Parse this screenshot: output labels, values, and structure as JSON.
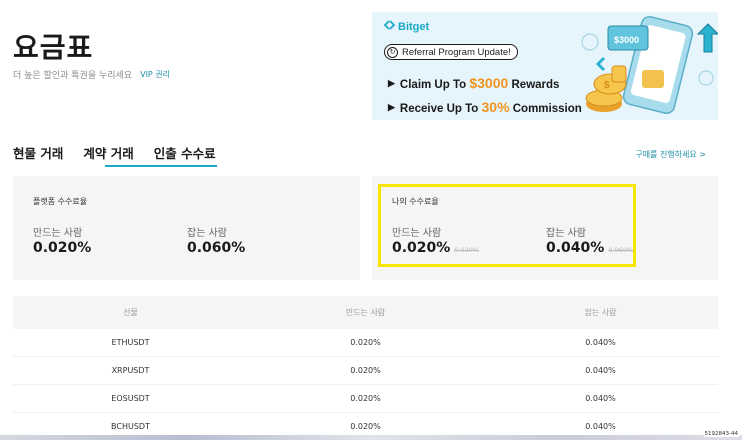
{
  "header": {
    "title": "요금표",
    "subtitle": "더 높은 할인과 특권을 누리세요",
    "vip_link": "VIP 권리"
  },
  "banner": {
    "brand": "Bitget",
    "pill_text": "Referral Program Update!",
    "line1_prefix": "Claim Up To ",
    "line1_highlight": "$3000",
    "line1_suffix": " Rewards",
    "line2_prefix": "Receive Up To ",
    "line2_highlight": "30%",
    "line2_suffix": " Commission",
    "colors": {
      "background": "#e6f5fb",
      "brand": "#1aa9c9",
      "highlight": "#f0941e"
    }
  },
  "tabs": [
    {
      "label": "현물 거래",
      "active": false
    },
    {
      "label": "계약 거래",
      "active": true
    },
    {
      "label": "인출 수수료",
      "active": true
    }
  ],
  "purchase_link": "구매를 진행하세요 >",
  "platform_card": {
    "title": "플랫폼 수수료율",
    "maker_label": "만드는 사람",
    "maker_value": "0.020%",
    "taker_label": "잡는 사람",
    "taker_value": "0.060%"
  },
  "my_card": {
    "title": "나의 수수료율",
    "maker_label": "만드는 사람",
    "maker_value": "0.020%",
    "maker_old": "0.020%",
    "taker_label": "잡는 사람",
    "taker_value": "0.040%",
    "taker_old": "0.060%",
    "highlight_color": "#f7e600"
  },
  "table": {
    "headers": [
      "선물",
      "만드는 사람",
      "잡는 사람"
    ],
    "rows": [
      [
        "ETHUSDT",
        "0.020%",
        "0.040%"
      ],
      [
        "XRPUSDT",
        "0.020%",
        "0.040%"
      ],
      [
        "EOSUSDT",
        "0.020%",
        "0.040%"
      ],
      [
        "BCHUSDT",
        "0.020%",
        "0.040%"
      ]
    ]
  },
  "corner_id": "5192843-44",
  "accent": "#1aa9c9"
}
